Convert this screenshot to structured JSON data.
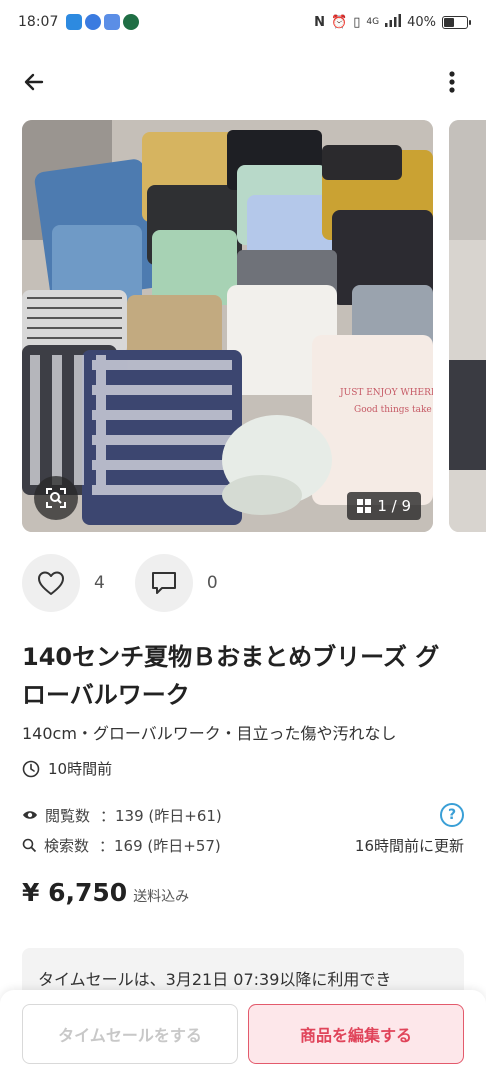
{
  "status_bar": {
    "time": "18:07",
    "network": "4G",
    "battery": "40%",
    "battery_level": 0.4
  },
  "gallery": {
    "counter": "1 / 9"
  },
  "actions": {
    "likes": "4",
    "comments": "0"
  },
  "item": {
    "title": "140センチ夏物Ｂおまとめブリーズ グローバルワーク",
    "subtitle": "140cm・グローバルワーク・目立った傷や汚れなし",
    "posted": "10時間前"
  },
  "stats": {
    "views_label": "閲覧数",
    "views_value": "：139 (昨日+61)",
    "search_label": "検索数",
    "search_value": "：169 (昨日+57)",
    "updated": "16時間前に更新"
  },
  "price": {
    "amount": "¥ 6,750",
    "shipping": "送料込み"
  },
  "notice": "タイムセールは、3月21日 07:39以降に利用でき",
  "buttons": {
    "time_sale": "タイムセールをする",
    "edit": "商品を編集する"
  },
  "colors": {
    "accent": "#e0445a",
    "help": "#3a9fd6"
  }
}
